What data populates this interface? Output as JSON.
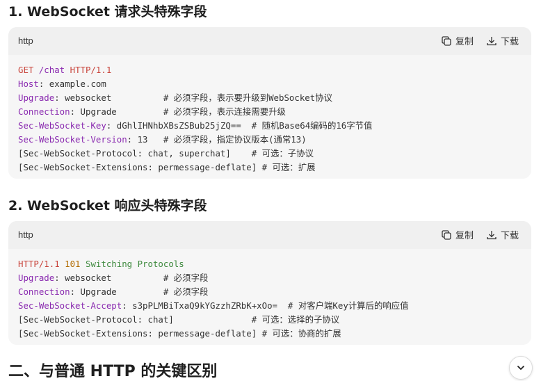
{
  "section1": {
    "heading": "1. WebSocket 请求头特殊字段",
    "lang": "http",
    "copy_label": "复制",
    "download_label": "下载",
    "lines": [
      [
        {
          "t": "GET ",
          "c": "red"
        },
        {
          "t": "/chat",
          "c": "purple"
        },
        {
          "t": " HTTP/1.1",
          "c": "red"
        }
      ],
      [
        {
          "t": "Host",
          "c": "purple"
        },
        {
          "t": ": example.com",
          "c": "plain"
        }
      ],
      [
        {
          "t": "Upgrade",
          "c": "purple"
        },
        {
          "t": ": websocket          # 必须字段，表示要升级到WebSocket协议",
          "c": "plain"
        }
      ],
      [
        {
          "t": "Connection",
          "c": "purple"
        },
        {
          "t": ": Upgrade         # 必须字段，表示连接需要升级",
          "c": "plain"
        }
      ],
      [
        {
          "t": "Sec-WebSocket-Key",
          "c": "purple"
        },
        {
          "t": ": dGhlIHNhbXBsZSBub25jZQ==  # 随机Base64编码的16字节值",
          "c": "plain"
        }
      ],
      [
        {
          "t": "Sec-WebSocket-Version",
          "c": "purple"
        },
        {
          "t": ": 13   # 必须字段，指定协议版本(通常13)",
          "c": "plain"
        }
      ],
      [
        {
          "t": "[Sec-WebSocket-Protocol: chat, superchat]    # 可选：子协议",
          "c": "plain"
        }
      ],
      [
        {
          "t": "[Sec-WebSocket-Extensions: permessage-deflate] # 可选：扩展",
          "c": "plain"
        }
      ]
    ]
  },
  "section2": {
    "heading": "2. WebSocket 响应头特殊字段",
    "lang": "http",
    "copy_label": "复制",
    "download_label": "下载",
    "lines": [
      [
        {
          "t": "HTTP/1.1 ",
          "c": "red"
        },
        {
          "t": "101",
          "c": "orange"
        },
        {
          "t": " Switching Protocols",
          "c": "green"
        }
      ],
      [
        {
          "t": "Upgrade",
          "c": "purple"
        },
        {
          "t": ": websocket          # 必须字段",
          "c": "plain"
        }
      ],
      [
        {
          "t": "Connection",
          "c": "purple"
        },
        {
          "t": ": Upgrade         # 必须字段",
          "c": "plain"
        }
      ],
      [
        {
          "t": "Sec-WebSocket-Accept",
          "c": "purple"
        },
        {
          "t": ": s3pPLMBiTxaQ9kYGzzhZRbK+xOo=  # 对客户端Key计算后的响应值",
          "c": "plain"
        }
      ],
      [
        {
          "t": "[Sec-WebSocket-Protocol: chat]               # 可选：选择的子协议",
          "c": "plain"
        }
      ],
      [
        {
          "t": "[Sec-WebSocket-Extensions: permessage-deflate] # 可选：协商的扩展",
          "c": "plain"
        }
      ]
    ]
  },
  "section3": {
    "heading": "二、与普通 HTTP 的关键区别"
  },
  "icons": {
    "copy": "copy-icon",
    "download": "download-icon",
    "scroll": "chevron-down-icon"
  }
}
